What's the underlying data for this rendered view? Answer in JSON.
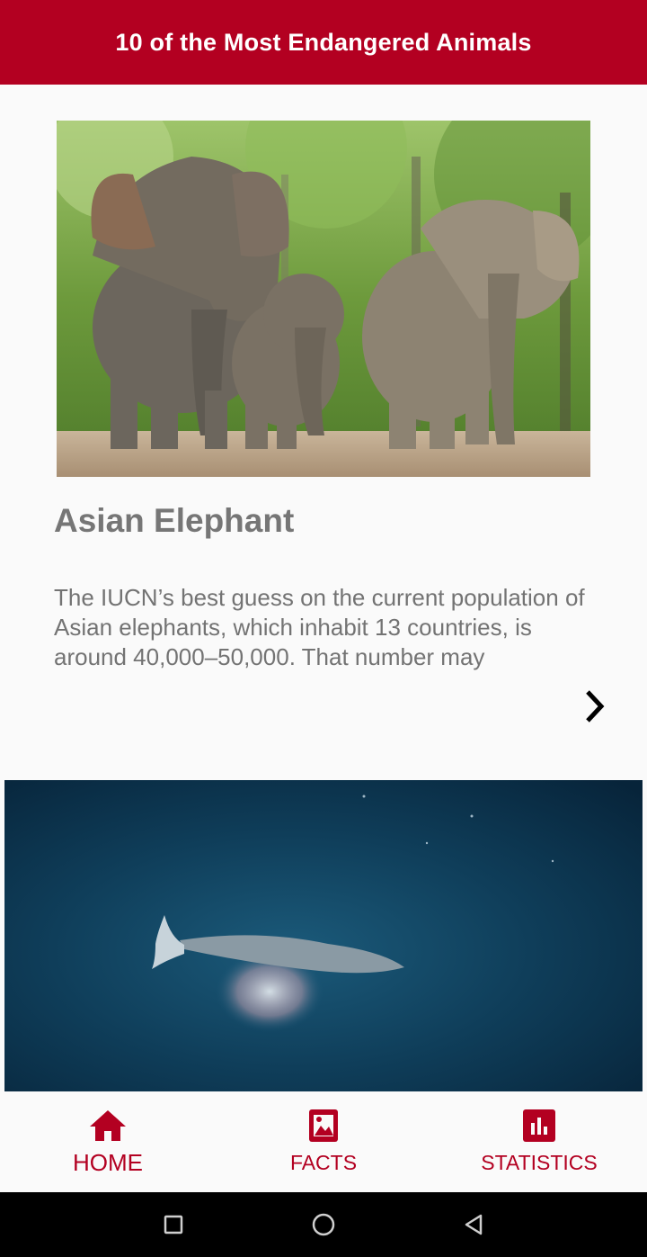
{
  "app_bar": {
    "title": "10 of the Most Endangered Animals"
  },
  "cards": [
    {
      "image_subject": "asian-elephants-walking",
      "title": "Asian Elephant",
      "description": "The IUCN’s best guess on the current population of Asian elephants, which inhabit 13 countries, is around 40,000–50,000. That number may",
      "next_icon": "chevron-right-icon"
    },
    {
      "image_subject": "whale-swimming-deep-ocean"
    }
  ],
  "bottom_nav": {
    "items": [
      {
        "label": "HOME",
        "icon": "home-icon",
        "active": true
      },
      {
        "label": "FACTS",
        "icon": "image-icon",
        "active": false
      },
      {
        "label": "STATISTICS",
        "icon": "bar-chart-icon",
        "active": false
      }
    ]
  },
  "system_nav": [
    "recents-square-icon",
    "home-circle-icon",
    "back-triangle-icon"
  ],
  "colors": {
    "accent": "#b30021",
    "background": "#fafafa",
    "text_gray": "#767676"
  }
}
